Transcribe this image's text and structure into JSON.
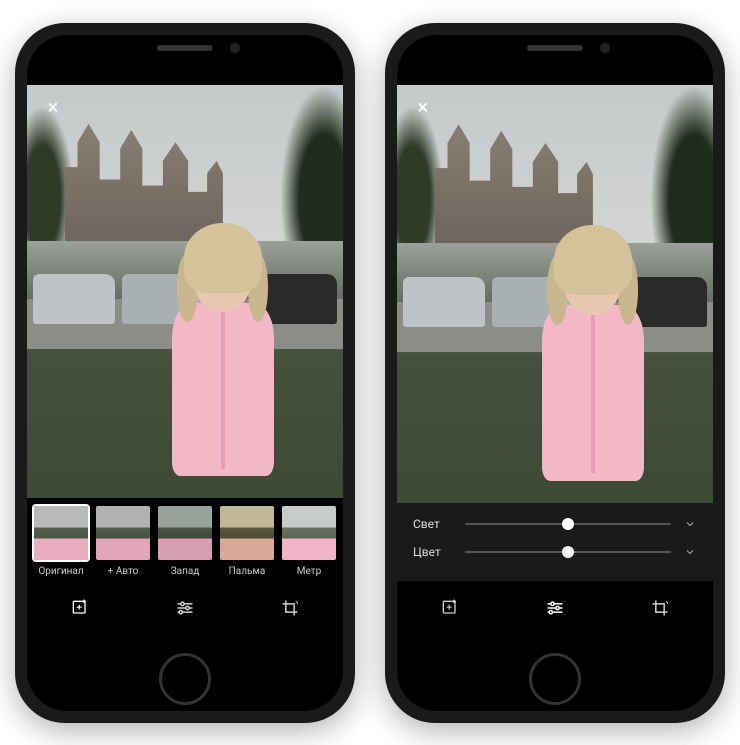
{
  "left_phone": {
    "close_label": "×",
    "filters": [
      {
        "label": "Оригинал",
        "variant": "f-original",
        "selected": true
      },
      {
        "label": "+ Авто",
        "variant": "f-auto",
        "selected": false
      },
      {
        "label": "Запад",
        "variant": "f-west",
        "selected": false
      },
      {
        "label": "Пальма",
        "variant": "f-palm",
        "selected": false
      },
      {
        "label": "Метр",
        "variant": "f-metro",
        "selected": false
      }
    ],
    "toolbar": {
      "filters_active": true,
      "adjust_active": false,
      "crop_active": false
    }
  },
  "right_phone": {
    "close_label": "×",
    "sliders": {
      "light": {
        "label": "Свет",
        "position": 50
      },
      "color": {
        "label": "Цвет",
        "position": 50
      }
    },
    "toolbar": {
      "filters_active": false,
      "adjust_active": true,
      "crop_active": false
    }
  },
  "icons": {
    "close": "close-icon",
    "auto_enhance": "sparkle-plus-icon",
    "adjust": "sliders-icon",
    "crop": "crop-rotate-icon",
    "chevron_down": "chevron-down-icon"
  }
}
